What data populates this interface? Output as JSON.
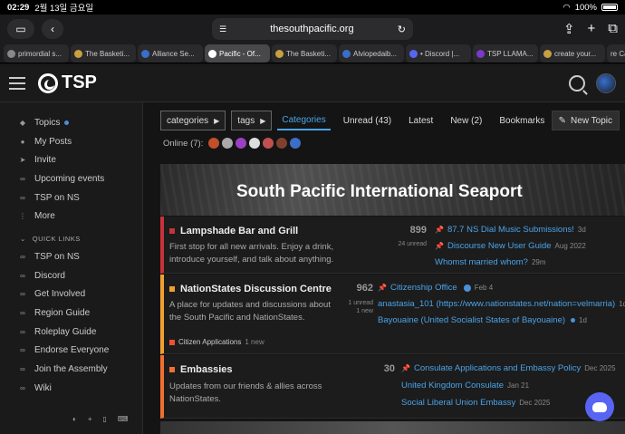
{
  "status": {
    "time": "02:29",
    "date": "2월 13일 금요일",
    "battery": "100%"
  },
  "browser": {
    "url": "thesouthpacific.org",
    "tabs": [
      {
        "label": "primordial s...",
        "color": "#888"
      },
      {
        "label": "The Basketi...",
        "color": "#c8a040"
      },
      {
        "label": "Alliance Se...",
        "color": "#3a6ec8"
      },
      {
        "label": "Pacific - Of...",
        "color": "#fff",
        "active": true
      },
      {
        "label": "The Basketi...",
        "color": "#c8a040"
      },
      {
        "label": "Alviopedaib...",
        "color": "#3a6ec8"
      },
      {
        "label": "• Discord |...",
        "color": "#5865f2"
      },
      {
        "label": "TSP LLAMA...",
        "color": "#7a3ac8"
      },
      {
        "label": "create your...",
        "color": "#c8a040"
      },
      {
        "label": "re Cal...",
        "color": "#888"
      }
    ]
  },
  "site": {
    "logo_text": "TSP"
  },
  "sidebar": {
    "items": [
      {
        "label": "Topics",
        "icon": "layers-icon",
        "dot": true
      },
      {
        "label": "My Posts",
        "icon": "user-icon"
      },
      {
        "label": "Invite",
        "icon": "send-icon"
      },
      {
        "label": "Upcoming events",
        "icon": "link-icon"
      },
      {
        "label": "TSP on NS",
        "icon": "link-icon"
      },
      {
        "label": "More",
        "icon": "more-icon"
      }
    ],
    "section_title": "QUICK LINKS",
    "links": [
      "TSP on NS",
      "Discord",
      "Get Involved",
      "Region Guide",
      "Roleplay Guide",
      "Endorse Everyone",
      "Join the Assembly",
      "Wiki"
    ]
  },
  "nav": {
    "categories_dd": "categories",
    "tags_dd": "tags",
    "links": [
      {
        "label": "Categories",
        "active": true
      },
      {
        "label": "Unread (43)"
      },
      {
        "label": "Latest"
      },
      {
        "label": "New (2)"
      },
      {
        "label": "Bookmarks"
      }
    ],
    "new_topic": "New Topic"
  },
  "online": {
    "label": "Online (7):",
    "users": [
      "#c0502a",
      "#aaa",
      "#9a40c0",
      "#ddd",
      "#c05050",
      "#804030",
      "#3a6ec8"
    ]
  },
  "banner": {
    "title": "South Pacific International Seaport"
  },
  "categories": [
    {
      "name": "Lampshade Bar and Grill",
      "color": "#c8323a",
      "desc": "First stop for all new arrivals. Enjoy a drink, introduce yourself, and talk about anything.",
      "count": "899",
      "count_sub": "24 unread",
      "topics": [
        {
          "title": "87.7 NS Dial Music Submissions!",
          "age": "3d",
          "pinned": true
        },
        {
          "title": "Discourse New User Guide",
          "age": "Aug 2022",
          "pinned": true
        },
        {
          "title": "Whomst married whom?",
          "age": "29m"
        }
      ]
    },
    {
      "name": "NationStates Discussion Centre",
      "color": "#f0a030",
      "desc": "A place for updates and discussions about the South Pacific and NationStates.",
      "count": "962",
      "count_sub1": "1 unread",
      "count_sub2": "1 new",
      "sub_name": "Citizen Applications",
      "sub_count": "1 new",
      "topics": [
        {
          "title": "Citizenship Office",
          "age": "Feb 4",
          "pinned": true,
          "badge": true
        },
        {
          "title": "anastasia_101 (https://www.nationstates.net/nation=velmarria)",
          "age": "1d"
        },
        {
          "title": "Bayouaine (United Socialist States of Bayouaine)",
          "age": "1d",
          "dot": true
        }
      ]
    },
    {
      "name": "Embassies",
      "color": "#f07030",
      "desc": "Updates from our friends & allies across NationStates.",
      "count": "30",
      "topics": [
        {
          "title": "Consulate Applications and Embassy Policy",
          "age": "Dec 2025",
          "pinned": true
        },
        {
          "title": "United Kingdom Consulate",
          "age": "Jan 21"
        },
        {
          "title": "Social Liberal Union Embassy",
          "age": "Dec 2025"
        }
      ]
    }
  ]
}
